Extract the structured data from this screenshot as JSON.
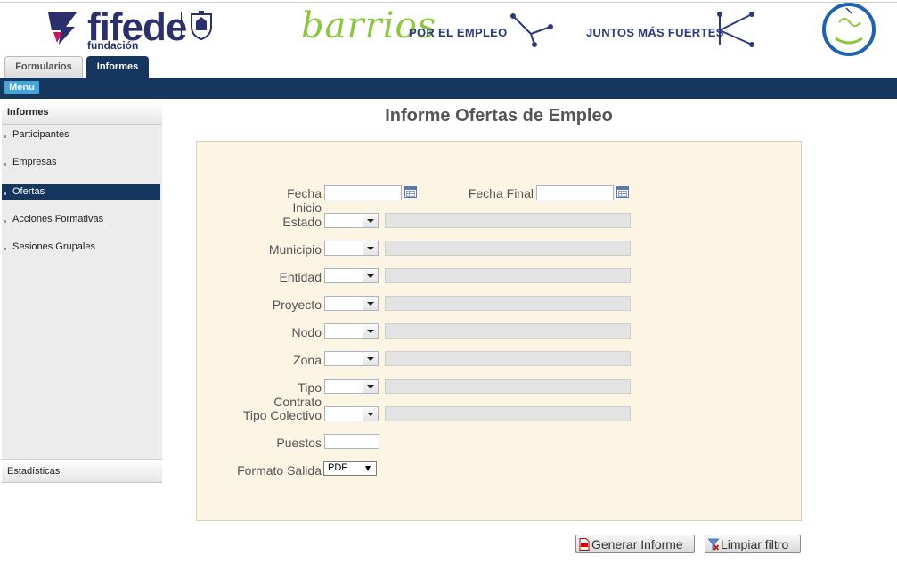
{
  "header": {
    "brand": "fifede",
    "brand_sub": "fundación",
    "campaign_word": "barrios",
    "campaign_tag": "POR EL EMPLEO",
    "slogan": "JUNTOS MÁS FUERTES"
  },
  "tabs": [
    {
      "label": "Formularios",
      "active": false
    },
    {
      "label": "Informes",
      "active": true
    }
  ],
  "menu_button": "Menu",
  "sidebar": {
    "title": "Informes",
    "items": [
      {
        "label": "Participantes",
        "active": false
      },
      {
        "label": "Empresas",
        "active": false
      },
      {
        "label": "Ofertas",
        "active": true
      },
      {
        "label": "Acciones Formativas",
        "active": false
      },
      {
        "label": "Sesiones Grupales",
        "active": false
      }
    ],
    "footer": "Estadísticas"
  },
  "main": {
    "title": "Informe Ofertas de Empleo",
    "fecha_inicio_label": "Fecha Inicio",
    "fecha_inicio_value": "",
    "fecha_final_label": "Fecha Final",
    "fecha_final_value": "",
    "filters": [
      {
        "label": "Estado"
      },
      {
        "label": "Municipio"
      },
      {
        "label": "Entidad"
      },
      {
        "label": "Proyecto"
      },
      {
        "label": "Nodo"
      },
      {
        "label": "Zona"
      },
      {
        "label": "Tipo Contrato"
      },
      {
        "label": "Tipo Colectivo"
      }
    ],
    "puestos_label": "Puestos",
    "puestos_value": "",
    "formato_label": "Formato Salida",
    "formato_value": "PDF"
  },
  "buttons": {
    "generar": "Generar Informe",
    "limpiar": "Limpiar filtro"
  },
  "colors": {
    "nav_dark": "#15365f",
    "menu_blue": "#43a5dc",
    "panel_bg": "#fcf5e4",
    "brand_green": "#8cc63f",
    "brand_navy": "#2b2f6b"
  }
}
